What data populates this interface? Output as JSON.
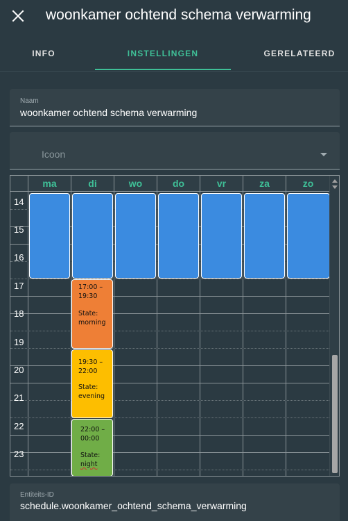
{
  "header": {
    "title": "woonkamer ochtend schema verwarming"
  },
  "tabs": [
    {
      "label": "INFO",
      "active": false
    },
    {
      "label": "INSTELLINGEN",
      "active": true
    },
    {
      "label": "GERELATEERD",
      "active": false
    }
  ],
  "name_field": {
    "label": "Naam",
    "value": "woonkamer ochtend schema verwarming"
  },
  "icon_field": {
    "label": "Icoon"
  },
  "schedule": {
    "days": [
      "ma",
      "di",
      "wo",
      "do",
      "vr",
      "za",
      "zo"
    ],
    "hours": [
      "14",
      "15",
      "16",
      "17",
      "18",
      "19",
      "20",
      "21",
      "22",
      "23"
    ],
    "blocks": [
      {
        "time": "17:00 – 19:30",
        "time_line1": "17:00 –",
        "time_line2": "19:30",
        "state_label": "State:",
        "state": "morning",
        "color": "#ee7f36"
      },
      {
        "time": "19:30 – 22:00",
        "time_line1": "19:30 –",
        "time_line2": "22:00",
        "state_label": "State:",
        "state": "evening",
        "color": "#fdbe00"
      },
      {
        "time": "22:00 – 00:00",
        "time_line1": "22:00 –",
        "time_line2": "00:00",
        "state_label": "State:",
        "state": "night",
        "color": "#70ad47"
      }
    ],
    "blue_color": "#3b8be0"
  },
  "entity_field": {
    "label": "Entiteits-ID",
    "value": "schedule.woonkamer_ochtend_schema_verwarming"
  },
  "colors": {
    "accent": "#3fbf97",
    "background": "#2b3a42"
  }
}
